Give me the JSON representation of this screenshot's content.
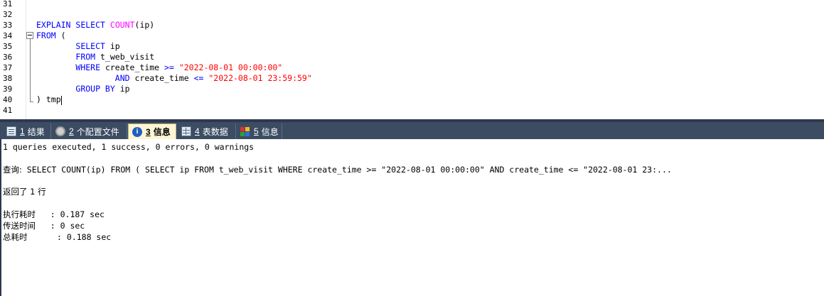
{
  "editor": {
    "lines": [
      {
        "num": "31",
        "segments": []
      },
      {
        "num": "32",
        "segments": []
      },
      {
        "num": "33",
        "segments": [
          {
            "t": "EXPLAIN",
            "c": "kw"
          },
          {
            "t": " "
          },
          {
            "t": "SELECT",
            "c": "kw"
          },
          {
            "t": " "
          },
          {
            "t": "COUNT",
            "c": "fn"
          },
          {
            "t": "(ip)"
          }
        ]
      },
      {
        "num": "34",
        "segments": [
          {
            "t": "FROM",
            "c": "kw"
          },
          {
            "t": " ("
          }
        ]
      },
      {
        "num": "35",
        "segments": [
          {
            "t": "        "
          },
          {
            "t": "SELECT",
            "c": "kw"
          },
          {
            "t": " ip"
          }
        ]
      },
      {
        "num": "36",
        "segments": [
          {
            "t": "        "
          },
          {
            "t": "FROM",
            "c": "kw"
          },
          {
            "t": " t_web_visit"
          }
        ]
      },
      {
        "num": "37",
        "segments": [
          {
            "t": "        "
          },
          {
            "t": "WHERE",
            "c": "kw"
          },
          {
            "t": " create_time "
          },
          {
            "t": ">=",
            "c": "kw"
          },
          {
            "t": " "
          },
          {
            "t": "\"2022-08-01 00:00:00\"",
            "c": "str"
          }
        ]
      },
      {
        "num": "38",
        "segments": [
          {
            "t": "                "
          },
          {
            "t": "AND",
            "c": "kw"
          },
          {
            "t": " create_time "
          },
          {
            "t": "<=",
            "c": "kw"
          },
          {
            "t": " "
          },
          {
            "t": "\"2022-08-01 23:59:59\"",
            "c": "str"
          }
        ]
      },
      {
        "num": "39",
        "segments": [
          {
            "t": "        "
          },
          {
            "t": "GROUP BY",
            "c": "kw"
          },
          {
            "t": " ip"
          }
        ]
      },
      {
        "num": "40",
        "segments": [
          {
            "t": ") tmp"
          }
        ]
      },
      {
        "num": "41",
        "segments": []
      }
    ]
  },
  "tabs": [
    {
      "num": "1",
      "label": "结果",
      "icon": "result-grid-icon"
    },
    {
      "num": "2",
      "label": "个配置文件",
      "icon": "profile-gear-icon"
    },
    {
      "num": "3",
      "label": "信息",
      "icon": "info-icon",
      "active": true
    },
    {
      "num": "4",
      "label": "表数据",
      "icon": "table-data-icon"
    },
    {
      "num": "5",
      "label": "信息",
      "icon": "info-blocks-icon"
    }
  ],
  "output": {
    "summary": "1 queries executed, 1 success, 0 errors, 0 warnings",
    "query_label": "查询:",
    "query_text": " SELECT COUNT(ip) FROM ( SELECT ip FROM t_web_visit WHERE create_time >= \"2022-08-01 00:00:00\" AND create_time <= \"2022-08-01 23:...",
    "returned": "返回了 1 行",
    "stats": [
      {
        "label": "执行耗时",
        "value": "   : 0.187 sec"
      },
      {
        "label": "传送时间",
        "value": "   : 0 sec"
      },
      {
        "label": "总耗时",
        "value": "      : 0.188 sec"
      }
    ]
  }
}
